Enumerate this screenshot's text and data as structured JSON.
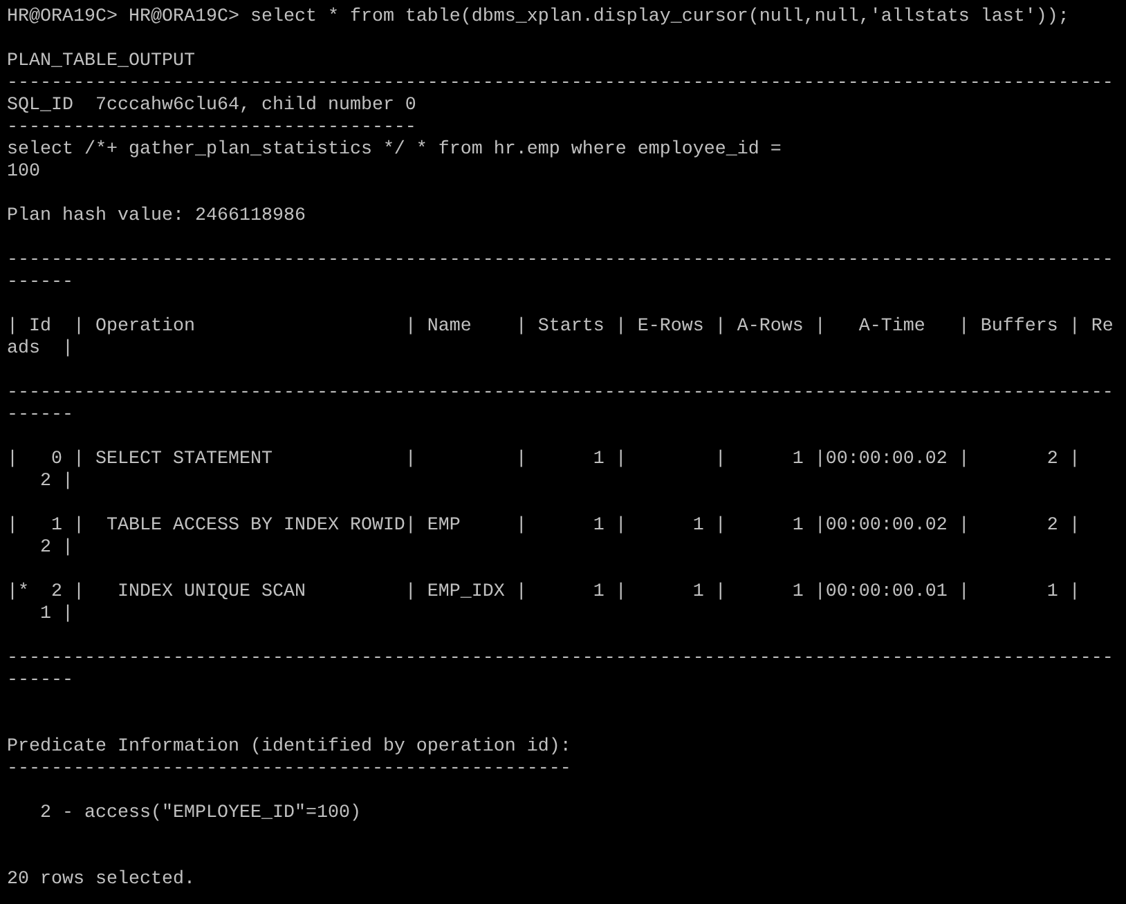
{
  "terminal": {
    "lines": [
      {
        "kind": "text",
        "text": "HR@ORA19C> HR@ORA19C> select * from table(dbms_xplan.display_cursor(null,null,'allstats last'));"
      },
      {
        "kind": "blank"
      },
      {
        "kind": "text",
        "text": "PLAN_TABLE_OUTPUT"
      },
      {
        "kind": "rule",
        "text": "----------------------------------------------------------------------------------------------------"
      },
      {
        "kind": "text",
        "text": "SQL_ID  7cccahw6clu64, child number 0"
      },
      {
        "kind": "rule",
        "text": "-------------------------------------"
      },
      {
        "kind": "text",
        "text": "select /*+ gather_plan_statistics */ * from hr.emp where employee_id ="
      },
      {
        "kind": "text",
        "text": "100"
      },
      {
        "kind": "blank"
      },
      {
        "kind": "text",
        "text": "Plan hash value: 2466118986"
      },
      {
        "kind": "blank"
      },
      {
        "kind": "rule",
        "text": "----------------------------------------------------------------------------------------------------"
      },
      {
        "kind": "rule",
        "text": "------"
      },
      {
        "kind": "blank"
      },
      {
        "kind": "text",
        "text": "| Id  | Operation                   | Name    | Starts | E-Rows | A-Rows |   A-Time   | Buffers | Re"
      },
      {
        "kind": "text",
        "text": "ads  |"
      },
      {
        "kind": "blank"
      },
      {
        "kind": "rule",
        "text": "----------------------------------------------------------------------------------------------------"
      },
      {
        "kind": "rule",
        "text": "------"
      },
      {
        "kind": "blank"
      },
      {
        "kind": "text",
        "text": "|   0 | SELECT STATEMENT            |         |      1 |        |      1 |00:00:00.02 |       2 |"
      },
      {
        "kind": "text",
        "text": "   2 |"
      },
      {
        "kind": "blank"
      },
      {
        "kind": "text",
        "text": "|   1 |  TABLE ACCESS BY INDEX ROWID| EMP     |      1 |      1 |      1 |00:00:00.02 |       2 |"
      },
      {
        "kind": "text",
        "text": "   2 |"
      },
      {
        "kind": "blank"
      },
      {
        "kind": "text",
        "text": "|*  2 |   INDEX UNIQUE SCAN         | EMP_IDX |      1 |      1 |      1 |00:00:00.01 |       1 |"
      },
      {
        "kind": "text",
        "text": "   1 |"
      },
      {
        "kind": "blank"
      },
      {
        "kind": "rule",
        "text": "----------------------------------------------------------------------------------------------------"
      },
      {
        "kind": "rule",
        "text": "------"
      },
      {
        "kind": "blank"
      },
      {
        "kind": "blank"
      },
      {
        "kind": "text",
        "text": "Predicate Information (identified by operation id):"
      },
      {
        "kind": "rule",
        "text": "---------------------------------------------------"
      },
      {
        "kind": "blank"
      },
      {
        "kind": "text",
        "text": "   2 - access(\"EMPLOYEE_ID\"=100)"
      },
      {
        "kind": "blank"
      },
      {
        "kind": "blank"
      },
      {
        "kind": "text",
        "text": "20 rows selected."
      }
    ]
  }
}
